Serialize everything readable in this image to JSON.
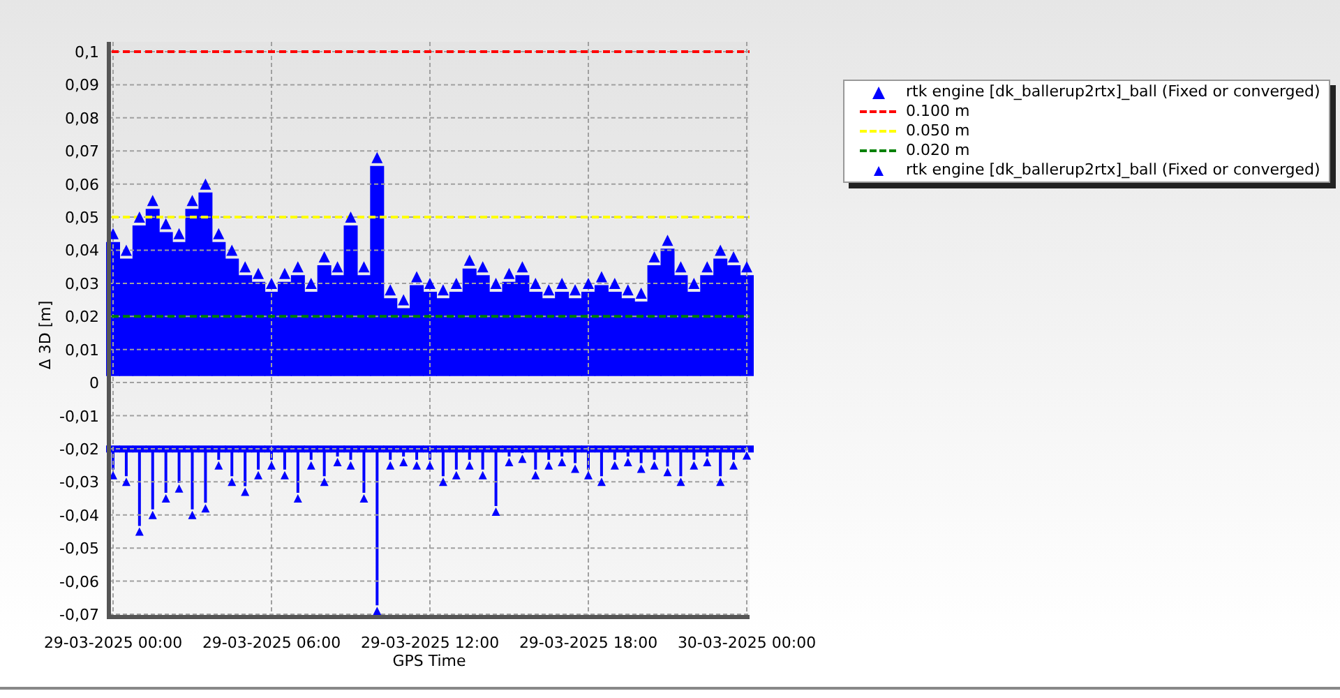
{
  "chart_data": {
    "type": "scatter",
    "xlabel": "GPS Time",
    "ylabel": "Δ 3D [m]",
    "ylim": [
      -0.07,
      0.1
    ],
    "grid": true,
    "yticks": [
      {
        "value": 0.1,
        "label": "0,1"
      },
      {
        "value": 0.09,
        "label": "0,09"
      },
      {
        "value": 0.08,
        "label": "0,08"
      },
      {
        "value": 0.07,
        "label": "0,07"
      },
      {
        "value": 0.06,
        "label": "0,06"
      },
      {
        "value": 0.05,
        "label": "0,05"
      },
      {
        "value": 0.04,
        "label": "0,04"
      },
      {
        "value": 0.03,
        "label": "0,03"
      },
      {
        "value": 0.02,
        "label": "0,02"
      },
      {
        "value": 0.01,
        "label": "0,01"
      },
      {
        "value": 0,
        "label": "0"
      },
      {
        "value": -0.01,
        "label": "-0,01"
      },
      {
        "value": -0.02,
        "label": "-0,02"
      },
      {
        "value": -0.03,
        "label": "-0,03"
      },
      {
        "value": -0.04,
        "label": "-0,04"
      },
      {
        "value": -0.05,
        "label": "-0,05"
      },
      {
        "value": -0.06,
        "label": "-0,06"
      },
      {
        "value": -0.07,
        "label": "-0,07"
      }
    ],
    "categories": [
      "29-03-2025 00:00",
      null,
      null,
      null,
      null,
      null,
      null,
      null,
      null,
      null,
      null,
      null,
      "29-03-2025 06:00",
      null,
      null,
      null,
      null,
      null,
      null,
      null,
      null,
      null,
      null,
      null,
      "29-03-2025 12:00",
      null,
      null,
      null,
      null,
      null,
      null,
      null,
      null,
      null,
      null,
      null,
      "29-03-2025 18:00",
      null,
      null,
      null,
      null,
      null,
      null,
      null,
      null,
      null,
      null,
      null,
      "30-03-2025 00:00"
    ],
    "series": [
      {
        "name": "rtk engine [dk_ballerup2rtx]_ball (Fixed or converged)",
        "color": "#0000ff",
        "values": [
          0.045,
          0.04,
          0.05,
          0.055,
          0.048,
          0.045,
          0.055,
          0.06,
          0.045,
          0.04,
          0.035,
          0.033,
          0.03,
          0.033,
          0.035,
          0.03,
          0.038,
          0.035,
          0.05,
          0.035,
          0.068,
          0.028,
          0.025,
          0.032,
          0.03,
          0.028,
          0.03,
          0.037,
          0.035,
          0.03,
          0.033,
          0.035,
          0.03,
          0.028,
          0.03,
          0.028,
          0.03,
          0.032,
          0.03,
          0.028,
          0.027,
          0.038,
          0.043,
          0.035,
          0.03,
          0.035,
          0.04,
          0.038,
          0.035
        ]
      },
      {
        "name": "rtk engine [dk_ballerup2rtx]_ball (Fixed or converged)",
        "color": "#0000ff",
        "values": [
          -0.028,
          -0.03,
          -0.045,
          -0.04,
          -0.035,
          -0.032,
          -0.04,
          -0.038,
          -0.025,
          -0.03,
          -0.033,
          -0.028,
          -0.025,
          -0.028,
          -0.035,
          -0.025,
          -0.03,
          -0.024,
          -0.025,
          -0.035,
          -0.069,
          -0.025,
          -0.024,
          -0.025,
          -0.025,
          -0.03,
          -0.028,
          -0.025,
          -0.028,
          -0.039,
          -0.024,
          -0.023,
          -0.028,
          -0.025,
          -0.024,
          -0.026,
          -0.028,
          -0.03,
          -0.025,
          -0.024,
          -0.026,
          -0.025,
          -0.027,
          -0.03,
          -0.025,
          -0.024,
          -0.03,
          -0.025,
          -0.022
        ]
      }
    ],
    "ref_lines": [
      {
        "label": "0.100 m",
        "axis": "y",
        "value": 0.1,
        "color": "#ff0000"
      },
      {
        "label": "0.050 m",
        "axis": "y",
        "value": 0.05,
        "color": "#ffff00"
      },
      {
        "label": "0.020 m",
        "axis": "y",
        "value": 0.02,
        "color": "#008000"
      }
    ]
  }
}
